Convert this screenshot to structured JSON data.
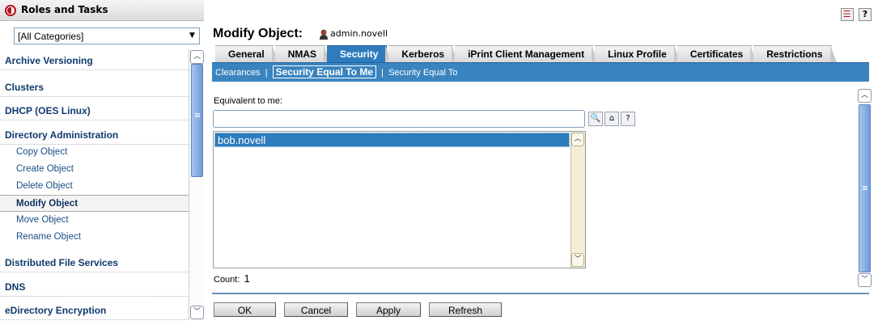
{
  "left_panel": {
    "title": "Roles and Tasks",
    "category_select": {
      "value": "[All Categories]"
    },
    "categories": [
      {
        "label": "Archive Versioning"
      },
      {
        "label": "Clusters"
      },
      {
        "label": "DHCP (OES Linux)"
      },
      {
        "label": "Directory Administration"
      },
      {
        "label": "Distributed File Services"
      },
      {
        "label": "DNS"
      },
      {
        "label": "eDirectory Encryption"
      }
    ],
    "tasks": [
      {
        "label": "Copy Object"
      },
      {
        "label": "Create Object"
      },
      {
        "label": "Delete Object"
      },
      {
        "label": "Modify Object",
        "active": true
      },
      {
        "label": "Move Object"
      },
      {
        "label": "Rename Object"
      }
    ]
  },
  "header": {
    "page_title": "Modify Object:",
    "object_name": "admin.novell",
    "top_icons": [
      {
        "icon": "task-list-icon",
        "glyph": "☰"
      },
      {
        "icon": "help-icon",
        "glyph": "?"
      }
    ]
  },
  "tabs": [
    {
      "label": "General"
    },
    {
      "label": "NMAS"
    },
    {
      "label": "Security",
      "active": true
    },
    {
      "label": "Kerberos"
    },
    {
      "label": "iPrint Client Management"
    },
    {
      "label": "Linux Profile"
    },
    {
      "label": "Certificates"
    },
    {
      "label": "Restrictions"
    }
  ],
  "subnav": {
    "items": [
      {
        "label": "Clearances"
      },
      {
        "label": "Security Equal To Me",
        "active": true
      },
      {
        "label": "Security Equal To"
      }
    ],
    "separator": "|"
  },
  "form": {
    "equivalent_label": "Equivalent to me:",
    "input_value": "",
    "input_icons": [
      {
        "icon": "object-selector-icon",
        "glyph": "🔍"
      },
      {
        "icon": "history-icon",
        "glyph": "⌂"
      },
      {
        "icon": "help-icon",
        "glyph": "?"
      }
    ],
    "list_items": [
      "bob.novell"
    ],
    "count_label": "Count:",
    "count_value": "1"
  },
  "buttons": {
    "ok": "OK",
    "cancel": "Cancel",
    "apply": "Apply",
    "refresh": "Refresh"
  },
  "colors": {
    "accent_blue": "#2e7bbd",
    "subnav_blue": "#3a84bf",
    "category_text": "#0f3a6b",
    "brand_red": "#b5121b"
  }
}
